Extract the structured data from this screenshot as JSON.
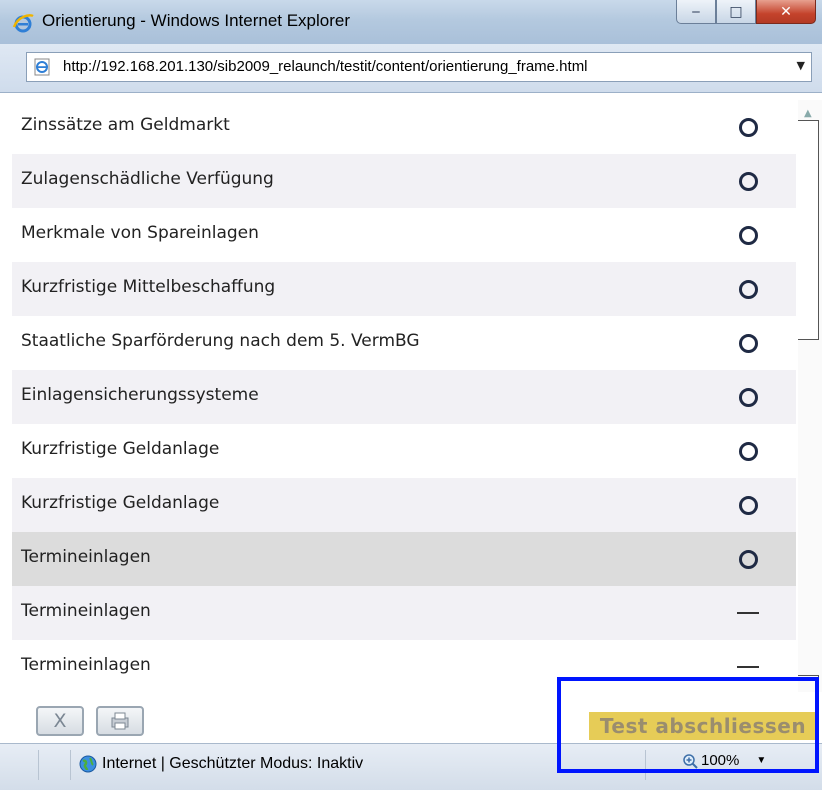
{
  "window": {
    "title": "Orientierung - Windows Internet Explorer",
    "url": "http://192.168.201.130/sib2009_relaunch/testit/content/orientierung_frame.html"
  },
  "rows": [
    {
      "label": "Zinssätze am Geldmarkt",
      "status": "circle"
    },
    {
      "label": "Zulagenschädliche Verfügung",
      "status": "circle"
    },
    {
      "label": "Merkmale von Spareinlagen",
      "status": "circle"
    },
    {
      "label": "Kurzfristige Mittelbeschaffung",
      "status": "circle"
    },
    {
      "label": "Staatliche Sparförderung nach dem 5. VermBG",
      "status": "circle"
    },
    {
      "label": "Einlagensicherungssysteme",
      "status": "circle"
    },
    {
      "label": "Kurzfristige Geldanlage",
      "status": "circle"
    },
    {
      "label": "Kurzfristige Geldanlage",
      "status": "circle"
    },
    {
      "label": "Termineinlagen",
      "status": "circle"
    },
    {
      "label": "Termineinlagen",
      "status": "dash"
    },
    {
      "label": "Termineinlagen",
      "status": "dash"
    }
  ],
  "buttons": {
    "close_label": "X",
    "finish_label": "Test abschliessen"
  },
  "statusbar": {
    "zone_text": "Internet | Geschützter Modus: Inaktiv",
    "zoom": "100%"
  },
  "colors": {
    "finish_bg": "#e6cc57",
    "annotation": "#0015ff",
    "highlight_row": "#dcdcdc"
  }
}
